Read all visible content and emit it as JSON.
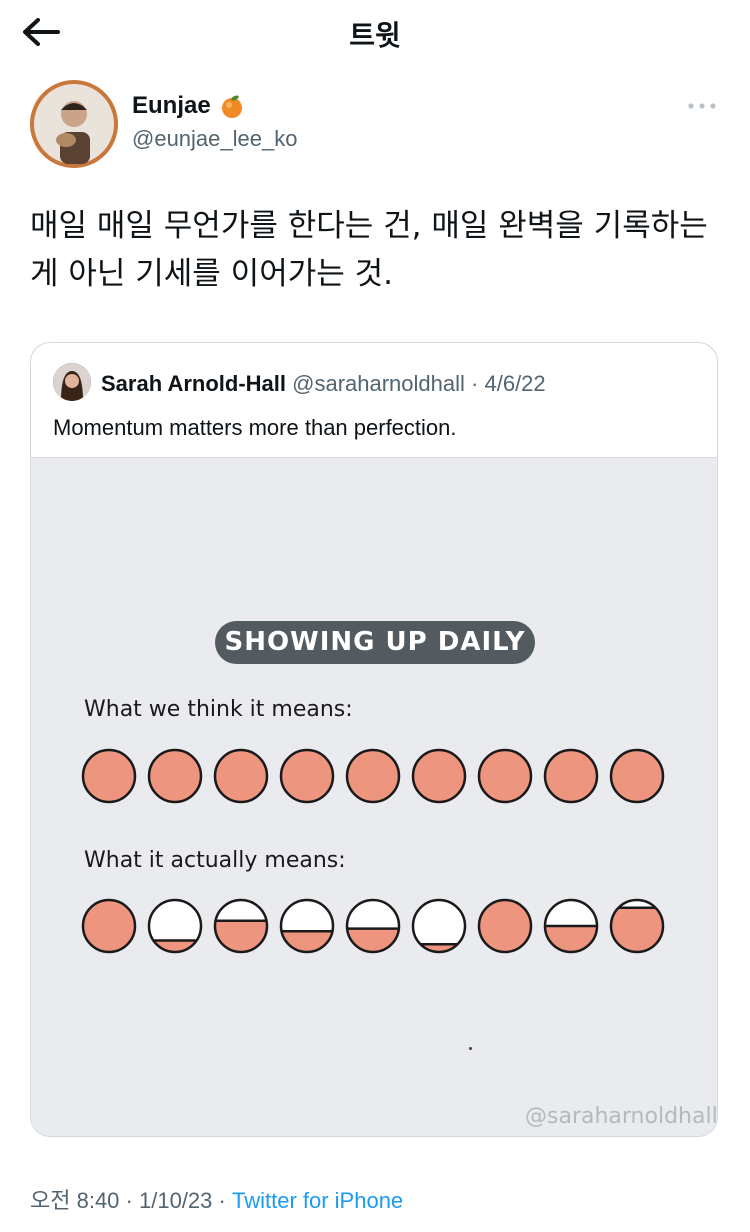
{
  "header": {
    "title": "트윗",
    "back_icon": "arrow-left-icon"
  },
  "author": {
    "name": "Eunjae",
    "emoji_icon": "tangerine-icon",
    "handle": "@eunjae_lee_ko",
    "more_icon": "more-horizontal-icon"
  },
  "tweet": {
    "text": "매일 매일 무언가를 한다는 건, 매일 완벽을 기록하는 게 아닌 기세를 이어가는 것."
  },
  "quote": {
    "name": "Sarah Arnold-Hall",
    "handle": "@saraharnoldhall",
    "separator": "·",
    "date": "4/6/22",
    "text": "Momentum matters more than perfection.",
    "image": {
      "title": "SHOWING UP DAILY",
      "think_label": "What we think it means:",
      "actual_label": "What it actually means:",
      "think_fills": [
        1,
        1,
        1,
        1,
        1,
        1,
        1,
        1,
        1
      ],
      "actual_fills": [
        1,
        0.22,
        0.6,
        0.4,
        0.45,
        0.15,
        1,
        0.5,
        0.85
      ],
      "fill_color": "#ee9580",
      "watermark": "@saraharnoldhall"
    }
  },
  "footer": {
    "time": "오전 8:40",
    "separator": "·",
    "date": "1/10/23",
    "source": "Twitter for iPhone"
  }
}
